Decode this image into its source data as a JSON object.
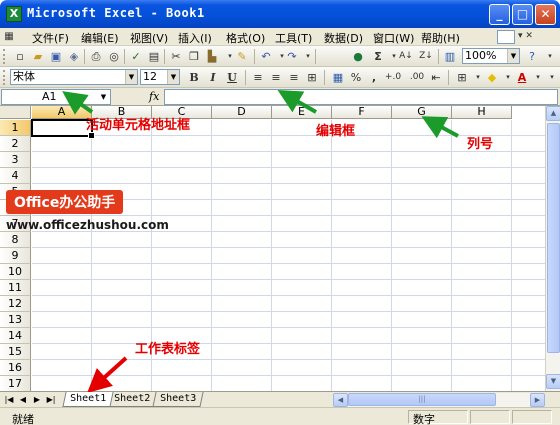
{
  "window": {
    "title": "Microsoft Excel - Book1",
    "app_icon": "X",
    "buttons": {
      "minimize": "_",
      "maximize": "□",
      "close": "✕"
    }
  },
  "menubar": {
    "items": [
      "文件(F)",
      "编辑(E)",
      "视图(V)",
      "插入(I)",
      "格式(O)",
      "工具(T)",
      "数据(D)",
      "窗口(W)",
      "帮助(H)"
    ]
  },
  "standard_toolbar": {
    "zoom": "100%"
  },
  "formatting_toolbar": {
    "font": "宋体",
    "font_size": "12",
    "bold": "B",
    "italic": "I",
    "underline": "U",
    "percent": "%",
    "comma": ",",
    "increase_decimal": "+.0",
    "decrease_decimal": ".00"
  },
  "formula_bar": {
    "name_box": "A1",
    "fx": "fx",
    "content": ""
  },
  "grid": {
    "columns": [
      "A",
      "B",
      "C",
      "D",
      "E",
      "F",
      "G",
      "H"
    ],
    "rows": [
      "1",
      "2",
      "3",
      "4",
      "5",
      "6",
      "7",
      "8",
      "9",
      "10",
      "11",
      "12",
      "13",
      "14",
      "15",
      "16",
      "17"
    ],
    "active_cell": "A1"
  },
  "sheet_tabs": [
    "Sheet1",
    "Sheet2",
    "Sheet3"
  ],
  "active_sheet": "Sheet1",
  "status_bar": {
    "left": "就绪",
    "right": "数字"
  },
  "annotations": {
    "name_box": "活动单元格地址框",
    "formula_bar": "编辑框",
    "column_number": "列号",
    "sheet_tab": "工作表标签"
  },
  "watermark": {
    "badge": "Office办公助手",
    "url": "www.officezhushou.com"
  },
  "colors": {
    "title_bar": "#0450d8",
    "annotation_text": "#e50000",
    "annotation_arrow_green": "#1a9b2a",
    "annotation_arrow_red": "#e50000"
  }
}
